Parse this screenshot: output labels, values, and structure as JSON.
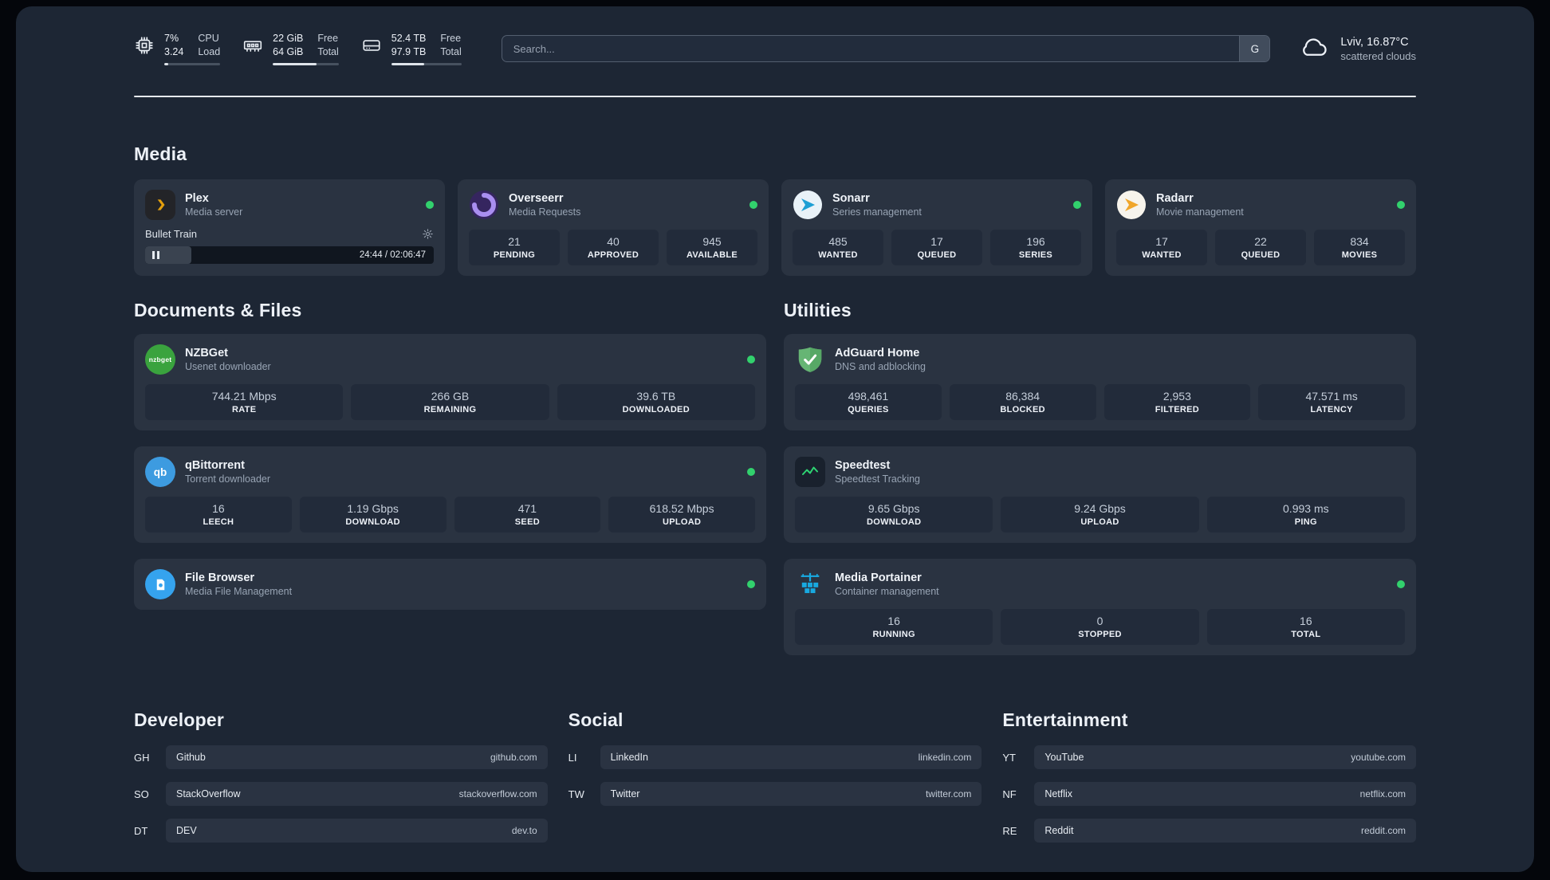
{
  "topbar": {
    "cpu": {
      "value_a": "7%",
      "value_b": "3.24",
      "label_a": "CPU",
      "label_b": "Load",
      "progress": 7
    },
    "memory": {
      "value_a": "22 GiB",
      "value_b": "64 GiB",
      "label_a": "Free",
      "label_b": "Total",
      "progress": 66
    },
    "disk": {
      "value_a": "52.4 TB",
      "value_b": "97.9 TB",
      "label_a": "Free",
      "label_b": "Total",
      "progress": 47
    },
    "search": {
      "placeholder": "Search...",
      "provider_label": "G"
    },
    "weather": {
      "location": "Lviv, 16.87°C",
      "condition": "scattered clouds"
    }
  },
  "media": {
    "heading": "Media",
    "plex": {
      "title": "Plex",
      "subtitle": "Media server",
      "now_playing": "Bullet Train",
      "time": "24:44 / 02:06:47",
      "progress": 16
    },
    "overseerr": {
      "title": "Overseerr",
      "subtitle": "Media Requests",
      "stats": [
        {
          "value": "21",
          "label": "PENDING"
        },
        {
          "value": "40",
          "label": "APPROVED"
        },
        {
          "value": "945",
          "label": "AVAILABLE"
        }
      ]
    },
    "sonarr": {
      "title": "Sonarr",
      "subtitle": "Series management",
      "stats": [
        {
          "value": "485",
          "label": "WANTED"
        },
        {
          "value": "17",
          "label": "QUEUED"
        },
        {
          "value": "196",
          "label": "SERIES"
        }
      ]
    },
    "radarr": {
      "title": "Radarr",
      "subtitle": "Movie management",
      "stats": [
        {
          "value": "17",
          "label": "WANTED"
        },
        {
          "value": "22",
          "label": "QUEUED"
        },
        {
          "value": "834",
          "label": "MOVIES"
        }
      ]
    }
  },
  "documents": {
    "heading": "Documents & Files",
    "nzbget": {
      "icon_text": "nzbget",
      "title": "NZBGet",
      "subtitle": "Usenet downloader",
      "stats": [
        {
          "value": "744.21 Mbps",
          "label": "RATE"
        },
        {
          "value": "266 GB",
          "label": "REMAINING"
        },
        {
          "value": "39.6 TB",
          "label": "DOWNLOADED"
        }
      ]
    },
    "qbittorrent": {
      "icon_text": "qb",
      "title": "qBittorrent",
      "subtitle": "Torrent downloader",
      "stats": [
        {
          "value": "16",
          "label": "LEECH"
        },
        {
          "value": "1.19 Gbps",
          "label": "DOWNLOAD"
        },
        {
          "value": "471",
          "label": "SEED"
        },
        {
          "value": "618.52 Mbps",
          "label": "UPLOAD"
        }
      ]
    },
    "filebrowser": {
      "title": "File Browser",
      "subtitle": "Media File Management"
    }
  },
  "utilities": {
    "heading": "Utilities",
    "adguard": {
      "title": "AdGuard Home",
      "subtitle": "DNS and adblocking",
      "stats": [
        {
          "value": "498,461",
          "label": "QUERIES"
        },
        {
          "value": "86,384",
          "label": "BLOCKED"
        },
        {
          "value": "2,953",
          "label": "FILTERED"
        },
        {
          "value": "47.571 ms",
          "label": "LATENCY"
        }
      ]
    },
    "speedtest": {
      "title": "Speedtest",
      "subtitle": "Speedtest Tracking",
      "stats": [
        {
          "value": "9.65 Gbps",
          "label": "DOWNLOAD"
        },
        {
          "value": "9.24 Gbps",
          "label": "UPLOAD"
        },
        {
          "value": "0.993 ms",
          "label": "PING"
        }
      ]
    },
    "portainer": {
      "title": "Media Portainer",
      "subtitle": "Container management",
      "stats": [
        {
          "value": "16",
          "label": "RUNNING"
        },
        {
          "value": "0",
          "label": "STOPPED"
        },
        {
          "value": "16",
          "label": "TOTAL"
        }
      ]
    }
  },
  "bookmarks": {
    "developer": {
      "heading": "Developer",
      "items": [
        {
          "abbr": "GH",
          "name": "Github",
          "url": "github.com"
        },
        {
          "abbr": "SO",
          "name": "StackOverflow",
          "url": "stackoverflow.com"
        },
        {
          "abbr": "DT",
          "name": "DEV",
          "url": "dev.to"
        }
      ]
    },
    "social": {
      "heading": "Social",
      "items": [
        {
          "abbr": "LI",
          "name": "LinkedIn",
          "url": "linkedin.com"
        },
        {
          "abbr": "TW",
          "name": "Twitter",
          "url": "twitter.com"
        }
      ]
    },
    "entertainment": {
      "heading": "Entertainment",
      "items": [
        {
          "abbr": "YT",
          "name": "YouTube",
          "url": "youtube.com"
        },
        {
          "abbr": "NF",
          "name": "Netflix",
          "url": "netflix.com"
        },
        {
          "abbr": "RE",
          "name": "Reddit",
          "url": "reddit.com"
        }
      ]
    }
  },
  "colors": {
    "status_green": "#32d16d",
    "plex_gold": "#e5a00d",
    "background": "#1d2634",
    "card": "#2a3341"
  }
}
